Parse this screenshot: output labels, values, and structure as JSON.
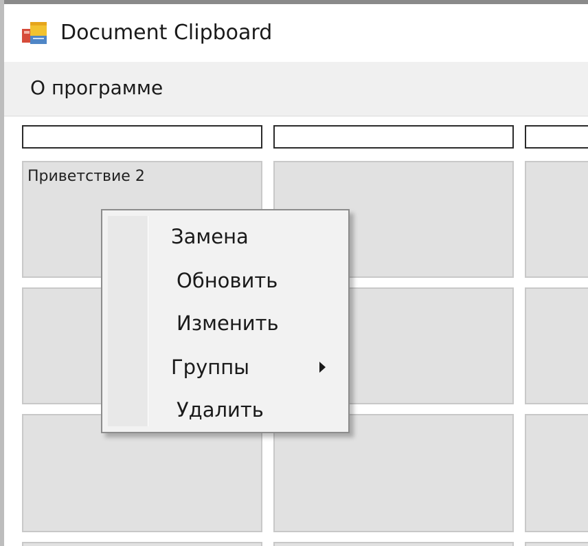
{
  "window": {
    "title": "Document Clipboard",
    "icon": "app-clipboard-icon"
  },
  "menubar": {
    "items": [
      {
        "label": "О программе"
      }
    ]
  },
  "grid": {
    "cell_label": "Приветствие 2"
  },
  "context_menu": {
    "items": [
      {
        "label": "Замена"
      },
      {
        "label": "Обновить"
      },
      {
        "label": "Изменить"
      },
      {
        "label": "Группы",
        "has_submenu": true
      },
      {
        "label": "Удалить"
      }
    ]
  }
}
